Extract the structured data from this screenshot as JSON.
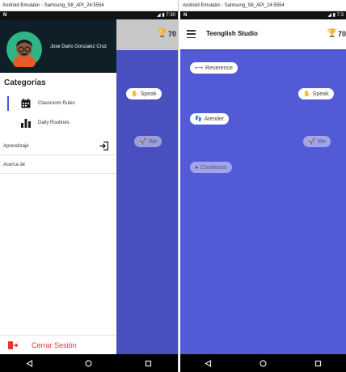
{
  "emulator": {
    "left_title": "Android Emulator - Samsung_S8_API_24:5554",
    "right_title": "Android Emulator - Samsung_S8_API_24:5554"
  },
  "statusbar": {
    "left_time": "7:30",
    "right_time": "7:3"
  },
  "drawer": {
    "user_name": "Jose Dario Gonzalez Cruz",
    "section_title": "Categorías",
    "items": [
      {
        "label": "Classroom Rules",
        "icon": "calendar-icon",
        "active": true
      },
      {
        "label": "Daily Routines",
        "icon": "bar-chart-icon",
        "active": false
      }
    ],
    "links": [
      {
        "label": "Aprendizaje",
        "icon": "login-icon"
      },
      {
        "label": "Acerca de"
      }
    ],
    "logout_label": "Cerrar Sesión"
  },
  "left_background": {
    "score": "70",
    "chips": [
      {
        "label": "Speak",
        "icon": "hand-icon",
        "faded": false
      },
      {
        "label": "We",
        "icon": "rocket-icon",
        "faded": true
      }
    ]
  },
  "app": {
    "title": "Teenglish Studio",
    "score": "70",
    "chips": [
      {
        "label": "Reverence",
        "icon": "arrows-horizontal-icon",
        "faded": false
      },
      {
        "label": "Speak",
        "icon": "hand-icon",
        "faded": false
      },
      {
        "label": "Atender",
        "icon": "footprints-icon",
        "faded": false
      },
      {
        "label": "We",
        "icon": "rocket-icon",
        "faded": true
      },
      {
        "label": "Courteous",
        "icon": "apple-icon",
        "faded": true
      }
    ]
  },
  "colors": {
    "canvas": "#535ad6",
    "drawer_header": "#0f1f27",
    "accent": "#3d5ad9",
    "logout": "#e8352a",
    "trophy": "#f2c200"
  }
}
